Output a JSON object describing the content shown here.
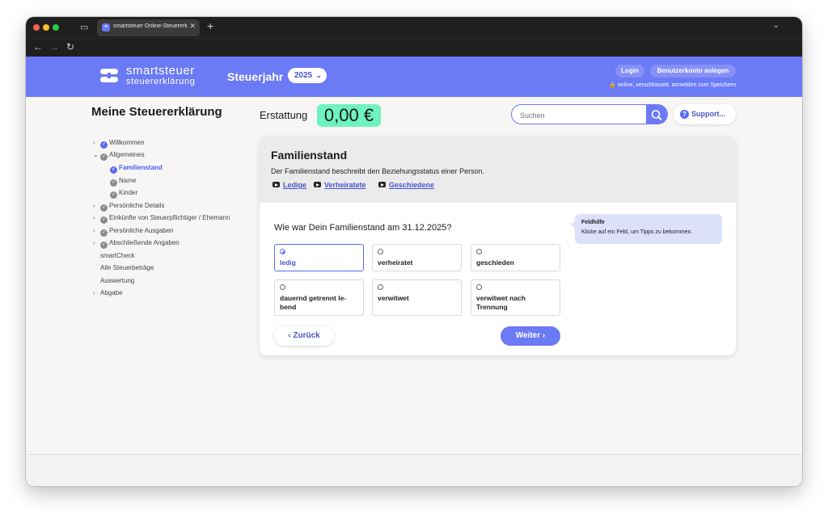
{
  "browser": {
    "tab_title": "smartsteuer Online-Steuererklä",
    "tab_close": "✕",
    "new_tab": "+"
  },
  "header": {
    "logo_line1": "smartsteuer",
    "logo_line2": "steuererklärung",
    "steuerjahr_label": "Steuerjahr",
    "year": "2025",
    "login": "Login",
    "register": "Benutzerkonto anlegen",
    "secure_note": "online, verschlüsselt, anmelden zum Speichern"
  },
  "sidebar": {
    "title": "Meine Steuererklärung",
    "items": [
      {
        "label": "Willkommen"
      },
      {
        "label": "Allgemeines"
      },
      {
        "label": "Familienstand"
      },
      {
        "label": "Name"
      },
      {
        "label": "Kinder"
      },
      {
        "label": "Persönliche Details"
      },
      {
        "label": "Einkünfte von Steuerpflichtiger / Ehemann"
      },
      {
        "label": "Persönliche Ausgaben"
      },
      {
        "label": "Abschließende Angaben"
      },
      {
        "label": "smartCheck"
      },
      {
        "label": "Alle Steuerbeträge"
      },
      {
        "label": "Auswertung"
      },
      {
        "label": "Abgabe"
      }
    ]
  },
  "topbar": {
    "erstattung_label": "Erstattung",
    "erstattung_value": "0,00 €",
    "search_placeholder": "Suchen",
    "support": "Support..."
  },
  "card": {
    "title": "Familienstand",
    "description": "Der Familienstand beschreibt den Beziehungsstatus einer Person.",
    "videos": [
      "Ledige",
      "Verheiratete",
      "Geschiedene"
    ],
    "question": "Wie war Dein Familienstand am 31.12.2025?",
    "options": [
      {
        "label": "ledig",
        "selected": true
      },
      {
        "label": "verheiratet",
        "selected": false
      },
      {
        "label": "geschieden",
        "selected": false
      },
      {
        "label": "dauernd getrennt le-bend",
        "selected": false
      },
      {
        "label": "verwitwet",
        "selected": false
      },
      {
        "label": "verwitwet nach Trennung",
        "selected": false
      }
    ],
    "back": "Zurück",
    "next": "Weiter",
    "tip_title": "Feldhilfe",
    "tip_text": "Klicke auf ein Feld, um Tipps zu bekommen."
  },
  "colors": {
    "brand": "#6b7af5",
    "refund_bg": "#6ff2c0",
    "tip_bg": "#dde0fb"
  }
}
